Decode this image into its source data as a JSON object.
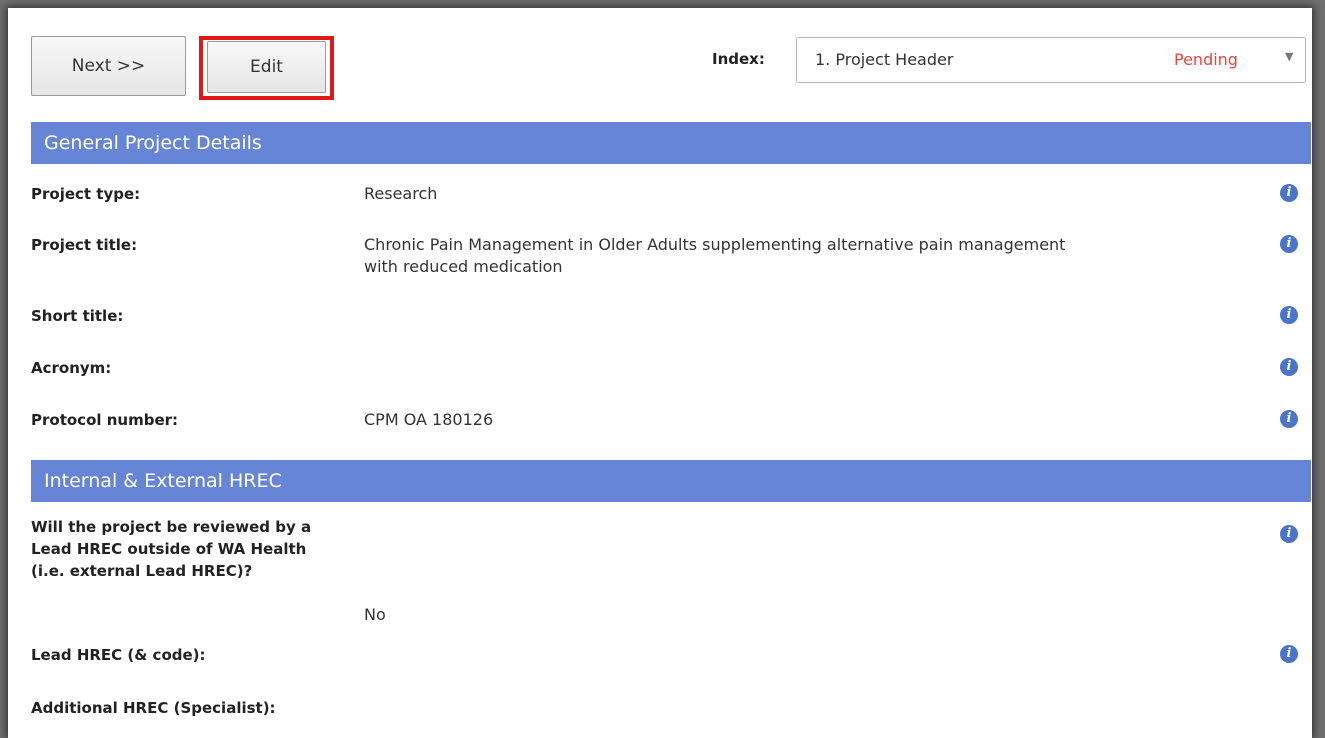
{
  "toolbar": {
    "next_label": "Next >>",
    "edit_label": "Edit"
  },
  "index": {
    "label": "Index:",
    "selected": "1. Project Header",
    "status": "Pending",
    "status_color": "#e8453c",
    "arrow_icon": "▼"
  },
  "sections": {
    "general": {
      "title": "General Project Details"
    },
    "hrec": {
      "title": "Internal & External HREC"
    }
  },
  "fields": {
    "project_type": {
      "label": "Project type:",
      "value": "Research"
    },
    "project_title": {
      "label": "Project title:",
      "value": "Chronic Pain Management in Older Adults supplementing alternative pain management with reduced medication"
    },
    "short_title": {
      "label": "Short title:",
      "value": ""
    },
    "acronym": {
      "label": "Acronym:",
      "value": ""
    },
    "protocol_number": {
      "label": "Protocol number:",
      "value": "CPM OA 180126"
    },
    "external_review": {
      "label": "Will the project be reviewed by a Lead HREC outside of WA Health (i.e. external Lead HREC)?",
      "value": "No"
    },
    "lead_hrec": {
      "label": "Lead HREC (& code):",
      "value": ""
    },
    "additional_hrec": {
      "label": "Additional HREC (Specialist):",
      "value": ""
    }
  },
  "icons": {
    "info": "i"
  },
  "colors": {
    "section_header_bg": "#6785d6",
    "highlight_border": "#e01818",
    "info_icon": "#4a74c9"
  }
}
